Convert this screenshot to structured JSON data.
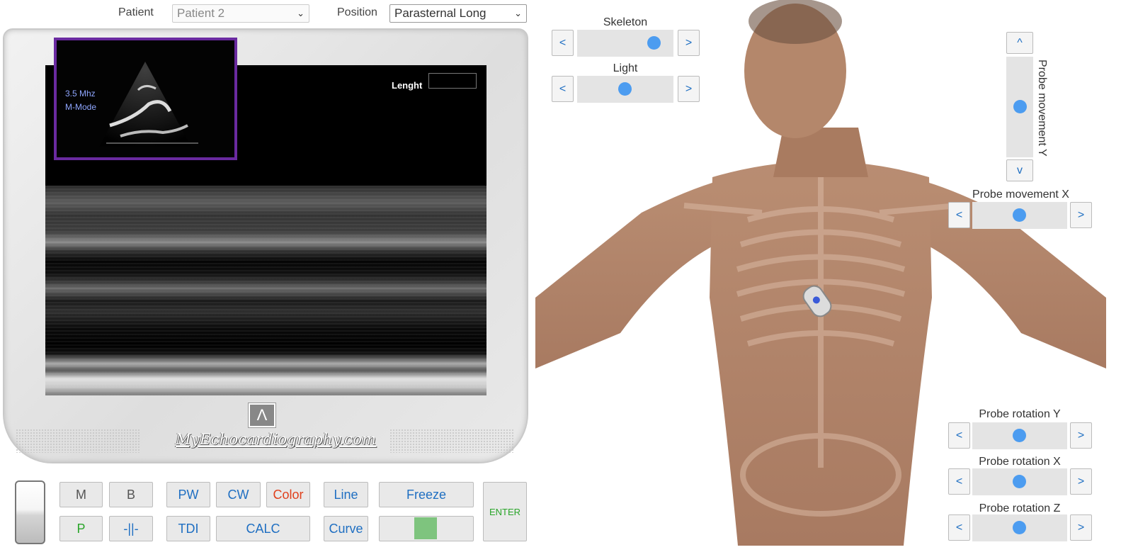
{
  "header": {
    "patient_label": "Patient",
    "patient_value": "Patient 2",
    "position_label": "Position",
    "position_value": "Parasternal Long"
  },
  "monitor": {
    "frequency": "3.5 Mhz",
    "mode": "M-Mode",
    "length_label": "Lenght",
    "length_value": "",
    "site_name": "MyEchocardiography.com"
  },
  "controls": {
    "row1": [
      {
        "key": "m",
        "label": "M"
      },
      {
        "key": "b",
        "label": "B"
      },
      {
        "key": "pw",
        "label": "PW"
      },
      {
        "key": "cw",
        "label": "CW"
      },
      {
        "key": "color",
        "label": "Color"
      },
      {
        "key": "line",
        "label": "Line"
      },
      {
        "key": "freeze",
        "label": "Freeze"
      }
    ],
    "row2": [
      {
        "key": "p",
        "label": "P"
      },
      {
        "key": "split",
        "label": "-||-"
      },
      {
        "key": "tdi",
        "label": "TDI"
      },
      {
        "key": "calc",
        "label": "CALC"
      },
      {
        "key": "curve",
        "label": "Curve"
      }
    ],
    "enter": "ENTER",
    "colors": {
      "blue": "#1f6fc2",
      "green": "#2aa52a",
      "red": "#e0401c",
      "status_green": "#7ec47e"
    }
  },
  "sliders": {
    "skeleton": {
      "label": "Skeleton",
      "value": 0.8
    },
    "light": {
      "label": "Light",
      "value": 0.5
    },
    "probe_movement_y": {
      "label": "Probe movement Y",
      "up": "^",
      "down": "v",
      "value": 0.5
    },
    "probe_movement_x": {
      "label": "Probe movement X",
      "value": 0.5
    },
    "probe_rotation_y": {
      "label": "Probe rotation Y",
      "value": 0.5
    },
    "probe_rotation_x": {
      "label": "Probe rotation X",
      "value": 0.5
    },
    "probe_rotation_z": {
      "label": "Probe rotation Z",
      "value": 0.5
    },
    "left": "<",
    "right": ">"
  }
}
